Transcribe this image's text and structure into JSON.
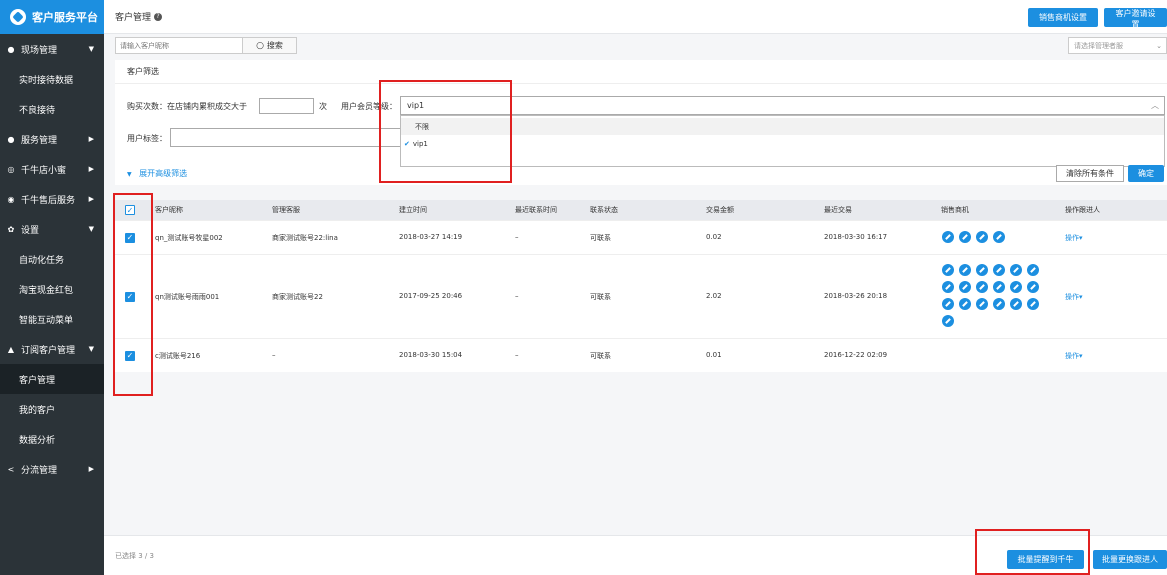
{
  "brand": {
    "title": "客户服务平台"
  },
  "sidebar": {
    "items": [
      {
        "label": "现场管理",
        "icon": "location-icon",
        "arrow": "▼"
      },
      {
        "label": "实时接待数据",
        "sub": true
      },
      {
        "label": "不良接待",
        "sub": true
      },
      {
        "label": "服务管理",
        "icon": "bell-icon",
        "arrow": "▶"
      },
      {
        "label": "千牛店小蜜",
        "icon": "robot-icon",
        "arrow": "▶"
      },
      {
        "label": "千牛售后服务",
        "icon": "shield-icon",
        "arrow": "▶"
      },
      {
        "label": "设置",
        "icon": "gear-icon",
        "arrow": "▼"
      },
      {
        "label": "自动化任务",
        "sub": true
      },
      {
        "label": "淘宝现金红包",
        "sub": true
      },
      {
        "label": "智能互动菜单",
        "sub": true
      },
      {
        "label": "订阅客户管理",
        "icon": "users-icon",
        "arrow": "▼"
      },
      {
        "label": "客户管理",
        "sub": true,
        "active": true
      },
      {
        "label": "我的客户",
        "sub": true
      },
      {
        "label": "数据分析",
        "sub": true
      },
      {
        "label": "分流管理",
        "icon": "share-icon",
        "arrow": "▶"
      }
    ]
  },
  "header": {
    "title": "客户管理",
    "btn_sales": "销售商机设置",
    "btn_invite": "客户邀请设置"
  },
  "search": {
    "placeholder": "请输入客户昵称",
    "button": "搜索",
    "manager_placeholder": "请选择管理者服"
  },
  "filter": {
    "title": "客户筛选",
    "purchase_label": "购买次数：在店铺内累积成交大于",
    "purchase_unit": "次",
    "level_label": "用户会员等级：",
    "level_value": "vip1",
    "options": [
      "不限",
      "vip1"
    ],
    "tag_label": "用户标签：",
    "expand": "展开高级筛选",
    "clear": "清除所有条件",
    "ok": "确定"
  },
  "table": {
    "headers": [
      "客户昵称",
      "管理客服",
      "建立时间",
      "最近联系时间",
      "联系状态",
      "交易金额",
      "最近交易",
      "销售商机",
      "操作跟进人"
    ],
    "rows": [
      {
        "name": "qn_测试账号牧星002",
        "staff": "商家测试账号22:lina",
        "created": "2018-03-27 14:19",
        "last_contact": "–",
        "status": "可联系",
        "amount": "0.02",
        "last_trade": "2018-03-30 16:17",
        "chances": 4,
        "op": "操作▾"
      },
      {
        "name": "qn测试账号雨雨001",
        "staff": "商家测试账号22",
        "created": "2017-09-25 20:46",
        "last_contact": "–",
        "status": "可联系",
        "amount": "2.02",
        "last_trade": "2018-03-26 20:18",
        "chances": 19,
        "op": "操作▾"
      },
      {
        "name": "c测试账号216",
        "staff": "–",
        "created": "2018-03-30 15:04",
        "last_contact": "–",
        "status": "可联系",
        "amount": "0.01",
        "last_trade": "2016-12-22 02:09",
        "chances": 0,
        "op": "操作▾"
      }
    ]
  },
  "footer": {
    "selected": "已选择 3 / 3",
    "btn_remind": "批量提醒到千牛",
    "btn_change": "批量更换跟进人"
  },
  "colors": {
    "accent": "#1c8fe0",
    "sidebar": "#2b3338",
    "highlight": "#e02020"
  }
}
